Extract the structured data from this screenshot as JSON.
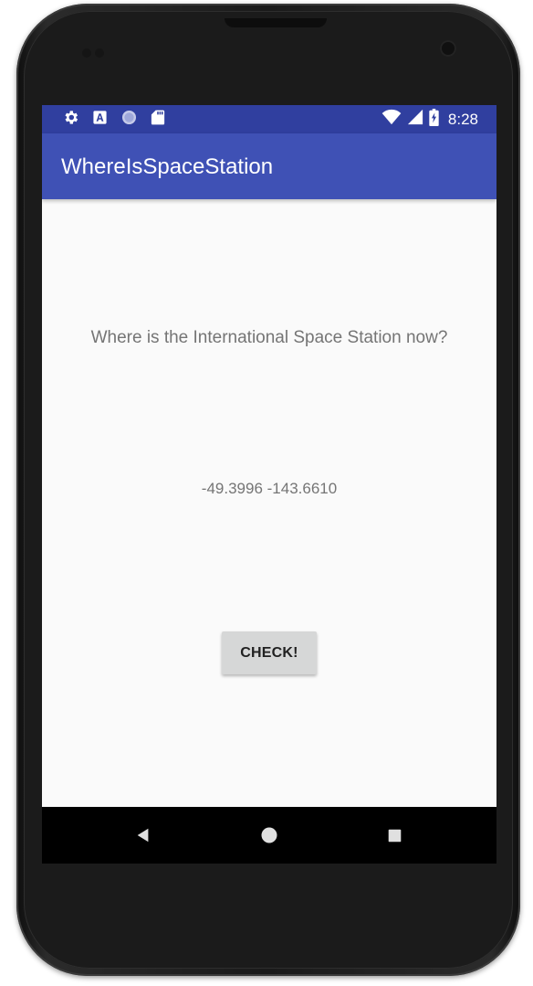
{
  "status_bar": {
    "time": "8:28",
    "left_icons": [
      "gear-icon",
      "font-a-icon",
      "sync-circle-icon",
      "sd-card-icon"
    ],
    "right_icons": [
      "wifi-icon",
      "cell-signal-icon",
      "battery-charging-icon"
    ]
  },
  "app_bar": {
    "title": "WhereIsSpaceStation"
  },
  "main": {
    "question": "Where is the International Space Station now?",
    "coordinates": "-49.3996 -143.6610",
    "check_button_label": "CHECK!"
  },
  "nav_bar": {
    "buttons": [
      "back-icon",
      "home-icon",
      "recents-icon"
    ]
  },
  "colors": {
    "status_bar": "#303f9f",
    "app_bar": "#3f51b5",
    "background": "#fafafa",
    "text_secondary": "#757575",
    "button": "#d6d7d7"
  }
}
